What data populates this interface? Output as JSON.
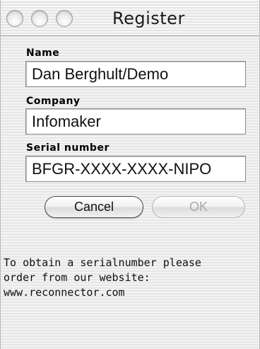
{
  "window": {
    "title": "Register"
  },
  "form": {
    "name": {
      "label": "Name",
      "value": "Dan Berghult/Demo"
    },
    "company": {
      "label": "Company",
      "value": "Infomaker"
    },
    "serial": {
      "label": "Serial number",
      "value": "BFGR-XXXX-XXXX-NIPO"
    }
  },
  "buttons": {
    "cancel_label": "Cancel",
    "ok_label": "OK",
    "ok_enabled": false
  },
  "info": {
    "line1": "To obtain a serialnumber please",
    "line2": "order from our website:",
    "line3": "www.reconnector.com"
  },
  "colors": {
    "window_stripe_light": "#f4f4f4",
    "window_stripe_dark": "#e6e6e6",
    "disabled_text": "#a8a8a8"
  }
}
